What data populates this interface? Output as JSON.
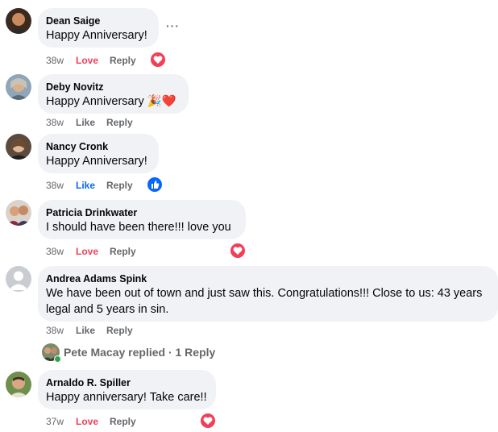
{
  "comments": [
    {
      "author": "Dean Saige",
      "text": "Happy Anniversary!",
      "time": "38w",
      "reaction_label": "Love",
      "reply_label": "Reply",
      "reaction_icon": "heart-reaction-icon",
      "more_label": "···"
    },
    {
      "author": "Deby Novitz",
      "text": "Happy Anniversary 🎉❤️",
      "time": "38w",
      "reaction_label": "Like",
      "reply_label": "Reply"
    },
    {
      "author": "Nancy Cronk",
      "text": "Happy Anniversary!",
      "time": "38w",
      "reaction_label": "Like",
      "reply_label": "Reply",
      "reaction_icon": "thumbs-up-reaction-icon"
    },
    {
      "author": "Patricia Drinkwater",
      "text": "I should have been there!!! love you",
      "time": "38w",
      "reaction_label": "Love",
      "reply_label": "Reply",
      "reaction_icon": "heart-reaction-icon"
    },
    {
      "author": "Andrea Adams Spink",
      "text": "We have been out of town and just saw this. Congratulations!!! Close to us: 43 years legal and 5 years in sin.",
      "time": "38w",
      "reaction_label": "Like",
      "reply_label": "Reply"
    },
    {
      "author": "Arnaldo R. Spiller",
      "text": "Happy anniversary! Take care!!",
      "time": "37w",
      "reaction_label": "Love",
      "reply_label": "Reply",
      "reaction_icon": "heart-reaction-icon"
    }
  ],
  "replies_link": {
    "text": "Pete Macay replied · 1 Reply"
  },
  "colors": {
    "love": "#f33e58",
    "like_active": "#0866ff",
    "meta": "#65676b",
    "bubble": "#f0f2f5"
  }
}
